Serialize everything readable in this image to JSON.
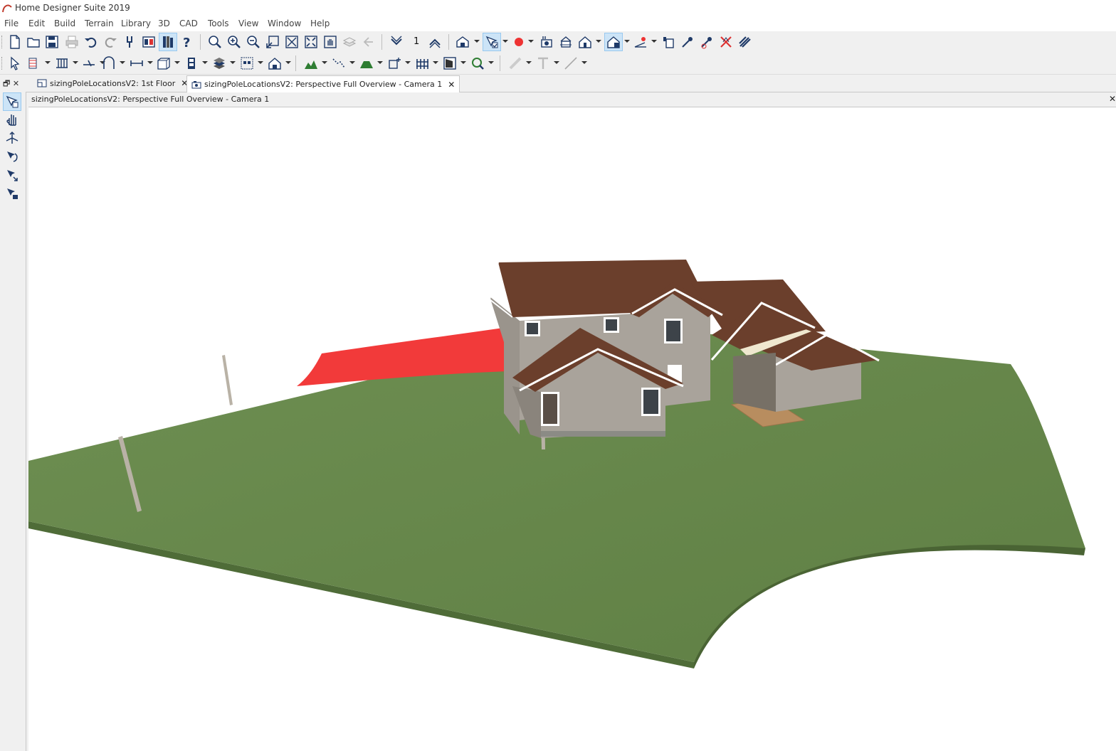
{
  "app": {
    "title": "Home Designer Suite 2019"
  },
  "menu": [
    "File",
    "Edit",
    "Build",
    "Terrain",
    "Library",
    "3D",
    "CAD",
    "Tools",
    "View",
    "Window",
    "Help"
  ],
  "toolbar1": {
    "floor_number": "1"
  },
  "tabs": [
    {
      "label": "sizingPoleLocationsV2: 1st Floor",
      "icon": "plan-icon",
      "close": "✕"
    },
    {
      "label": "sizingPoleLocationsV2: Perspective Full Overview - Camera 1",
      "icon": "camera-icon",
      "close": "✕"
    }
  ],
  "view": {
    "title": "sizingPoleLocationsV2: Perspective Full Overview - Camera 1",
    "close": "✕"
  },
  "scene": {
    "terrain_color": "#6a8a4e",
    "terrain_edge_color": "#4f6c38",
    "roof_color": "#6b3f2c",
    "wall_color": "#a9a39b",
    "trim_color": "#ffffff",
    "shade_sail_color": "#f23a3a",
    "pole_color": "#b9b2a6",
    "walkway_color": "#b88d5f"
  }
}
